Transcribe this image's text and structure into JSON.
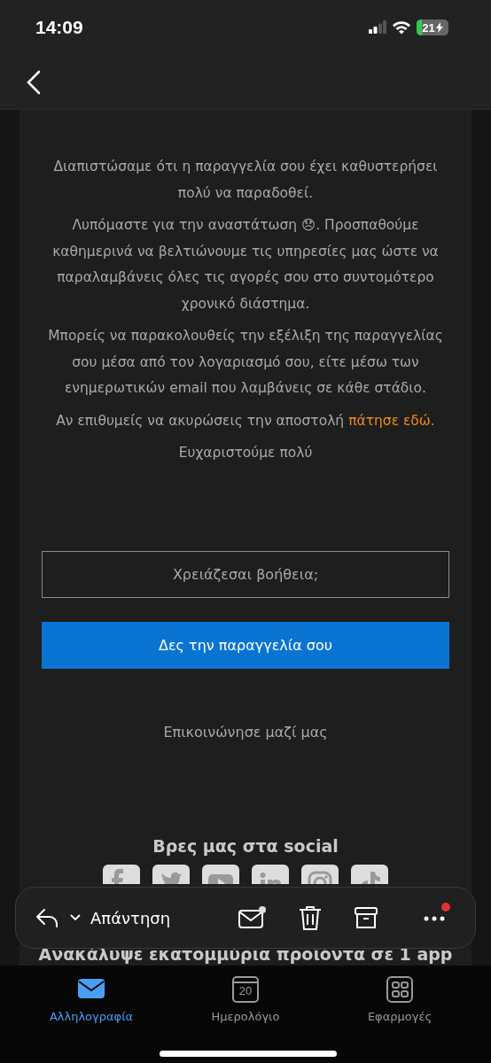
{
  "status_bar": {
    "time": "14:09",
    "battery": "21"
  },
  "email": {
    "paragraphs": [
      {
        "text": "Διαπιστώσαμε ότι η παραγγελία σου έχει καθυστερήσει πολύ να παραδοθεί."
      },
      {
        "text": "Λυπόμαστε για την αναστάτωση 😞. Προσπαθούμε καθημερινά να βελτιώνουμε τις υπηρεσίες μας ώστε να παραλαμβάνεις όλες τις αγορές σου στο συντομότερο χρονικό διάστημα."
      },
      {
        "text": "Μπορείς να παρακολουθείς την εξέλιξη της παραγγελίας σου μέσα από τον λογαριασμό σου, είτε μέσω των ενημερωτικών email που λαμβάνεις σε κάθε στάδιο."
      },
      {
        "text": "Αν επιθυμείς να ακυρώσεις την αποστολή",
        "link": "πάτησε εδώ."
      },
      {
        "text": "Ευχαριστούμε πολύ"
      }
    ],
    "help_button": "Χρειάζεσαι βοήθεια;",
    "order_button": "Δες την παραγγελία σου",
    "contact_link": "Επικοινώνησε μαζί μας",
    "social_heading": "Βρες μας στα social",
    "social": [
      {
        "kind": "facebook"
      },
      {
        "kind": "twitter"
      },
      {
        "kind": "youtube"
      },
      {
        "kind": "linkedin"
      },
      {
        "kind": "instagram"
      },
      {
        "kind": "tiktok"
      }
    ],
    "promo_heading": "Ανακάλυψε εκατομμύρια προϊόντα σε 1 app"
  },
  "toolbar": {
    "reply": "Απάντηση",
    "more_badge": true
  },
  "tabs": [
    {
      "kind": "mail",
      "label": "Αλληλογραφία",
      "selected": true
    },
    {
      "kind": "calendar",
      "label": "Ημερολόγιο",
      "selected": false,
      "day": "20"
    },
    {
      "kind": "apps",
      "label": "Εφαρμογές",
      "selected": false
    }
  ]
}
